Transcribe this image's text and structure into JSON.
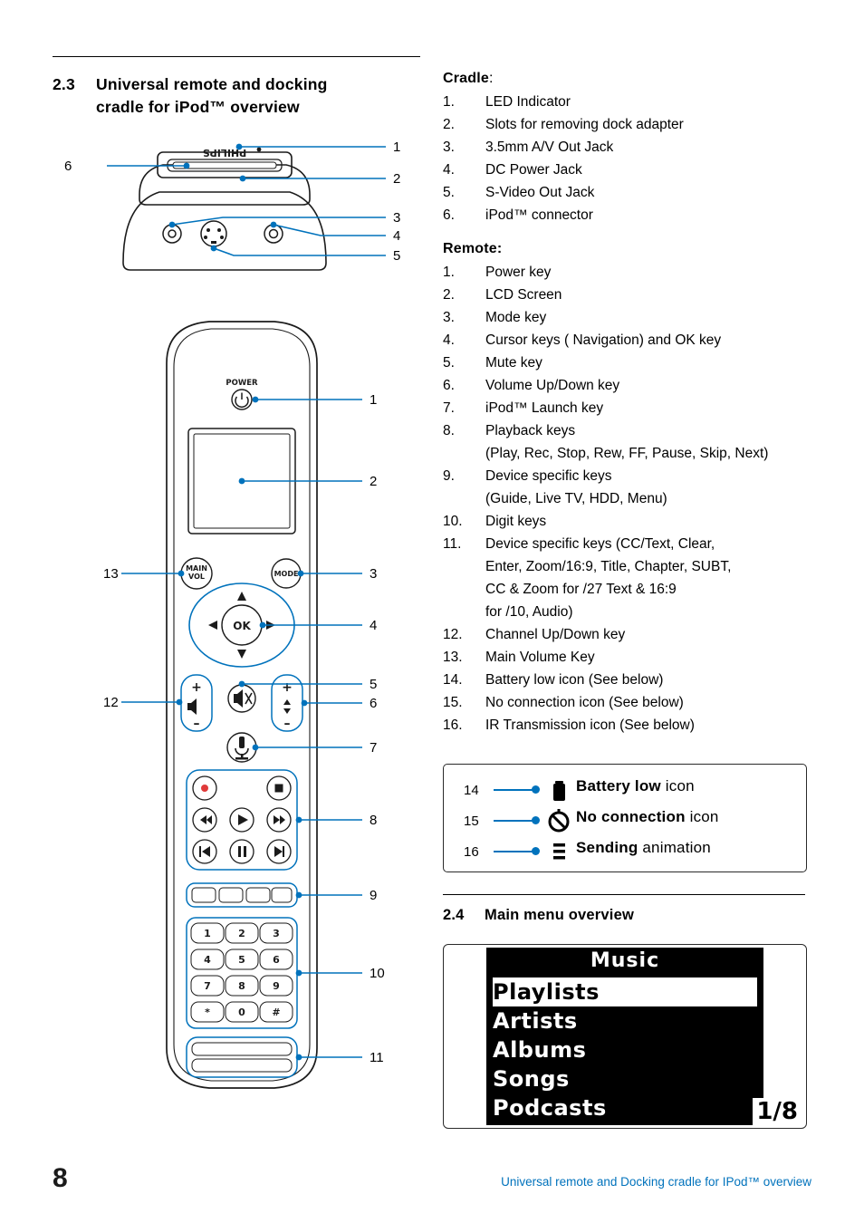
{
  "section_left": {
    "number": "2.3",
    "title_line1": "Universal remote and docking",
    "title_line2": "cradle for iPod™ overview"
  },
  "cradle": {
    "heading": "Cradle",
    "heading_suffix": ":",
    "items": [
      {
        "n": "1.",
        "t": "LED Indicator"
      },
      {
        "n": "2.",
        "t": "Slots for removing dock adapter"
      },
      {
        "n": "3.",
        "t": "3.5mm A/V Out Jack"
      },
      {
        "n": "4.",
        "t": "DC Power Jack"
      },
      {
        "n": "5.",
        "t": "S-Video Out Jack"
      },
      {
        "n": "6.",
        "t": "iPod™ connector"
      }
    ]
  },
  "remote": {
    "heading": "Remote:",
    "items": [
      {
        "n": "1.",
        "t": "Power key"
      },
      {
        "n": "2.",
        "t": "LCD Screen"
      },
      {
        "n": "3.",
        "t": "Mode key"
      },
      {
        "n": "4.",
        "t": "Cursor keys ( Navigation)  and OK key"
      },
      {
        "n": "5.",
        "t": "Mute key"
      },
      {
        "n": "6.",
        "t": "Volume Up/Down key"
      },
      {
        "n": "7.",
        "t": "iPod™ Launch key"
      },
      {
        "n": "8.",
        "t": "Playback keys"
      },
      {
        "n": "",
        "t": "(Play, Rec, Stop, Rew, FF, Pause, Skip, Next)"
      },
      {
        "n": "9.",
        "t": "Device specific keys"
      },
      {
        "n": "",
        "t": "(Guide, Live TV, HDD, Menu)"
      },
      {
        "n": "10.",
        "t": "Digit keys"
      },
      {
        "n": "11.",
        "t": "Device specific keys (CC/Text, Clear,"
      },
      {
        "n": "",
        "t": "Enter, Zoom/16:9, Title, Chapter, SUBT,"
      },
      {
        "n": "",
        "t": "CC & Zoom for /27 Text & 16:9"
      },
      {
        "n": "",
        "t": "for /10,  Audio)"
      },
      {
        "n": "12.",
        "t": "Channel Up/Down key"
      },
      {
        "n": "13.",
        "t": "Main Volume Key"
      },
      {
        "n": "14.",
        "t": "Battery low icon (See below)"
      },
      {
        "n": "15.",
        "t": "No connection icon (See below)"
      },
      {
        "n": "16.",
        "t": "IR Transmission icon (See below)"
      }
    ]
  },
  "icon_legend": {
    "rows": [
      {
        "ref": "14",
        "icon": "battery-low-icon",
        "bold": "Battery low",
        "plain": "icon"
      },
      {
        "ref": "15",
        "icon": "no-connection-icon",
        "bold": "No connection",
        "plain": "icon"
      },
      {
        "ref": "16",
        "icon": "sending-animation-icon",
        "bold": "Sending",
        "plain": "animation"
      }
    ]
  },
  "section_24": {
    "number": "2.4",
    "title": "Main menu overview"
  },
  "lcd_menu": {
    "title": "Music",
    "items": [
      "Playlists",
      "Artists",
      "Albums",
      "Songs",
      "Podcasts"
    ],
    "selected_index": 0,
    "page_indicator": "1/8"
  },
  "cradle_figure": {
    "brand": "PHILIPS",
    "callouts": [
      "1",
      "2",
      "3",
      "4",
      "5",
      "6"
    ]
  },
  "remote_figure": {
    "power_label": "POWER",
    "main_vol_label_1": "MAIN",
    "main_vol_label_2": "VOL",
    "mode_label": "MODE",
    "ok_label": "OK",
    "digits": [
      "1",
      "2",
      "3",
      "4",
      "5",
      "6",
      "7",
      "8",
      "9",
      "*",
      "0",
      "#"
    ],
    "callouts": [
      "1",
      "2",
      "3",
      "4",
      "5",
      "6",
      "7",
      "8",
      "9",
      "10",
      "11",
      "12",
      "13"
    ]
  },
  "footer": {
    "page_number": "8",
    "text": "Universal remote and Docking cradle for IPod™ overview"
  },
  "colors": {
    "accent_blue": "#0072bc",
    "line_dark": "#1b1b1b"
  }
}
